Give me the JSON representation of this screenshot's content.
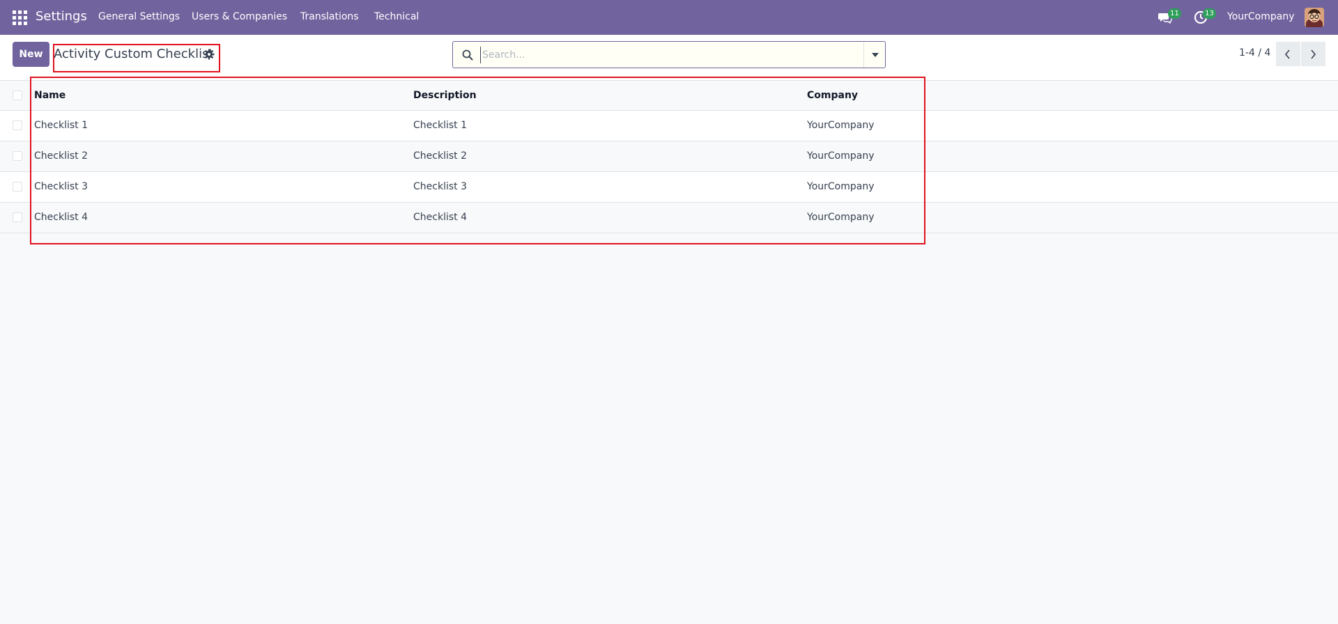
{
  "navbar": {
    "app_name": "Settings",
    "menu": [
      "General Settings",
      "Users & Companies",
      "Translations",
      "Technical"
    ],
    "messages_count": "11",
    "activities_count": "13",
    "company": "YourCompany",
    "color": "#71639e"
  },
  "control_panel": {
    "new_label": "New",
    "title": "Activity Custom Checklist",
    "search_placeholder": "Search...",
    "pager": "1-4 / 4"
  },
  "table": {
    "columns": [
      "Name",
      "Description",
      "Company"
    ],
    "rows": [
      {
        "name": "Checklist 1",
        "description": "Checklist 1",
        "company": "YourCompany"
      },
      {
        "name": "Checklist 2",
        "description": "Checklist 2",
        "company": "YourCompany"
      },
      {
        "name": "Checklist 3",
        "description": "Checklist 3",
        "company": "YourCompany"
      },
      {
        "name": "Checklist 4",
        "description": "Checklist 4",
        "company": "YourCompany"
      }
    ]
  },
  "colors": {
    "highlight": "#e0101e",
    "badge": "#2e9f5a"
  }
}
